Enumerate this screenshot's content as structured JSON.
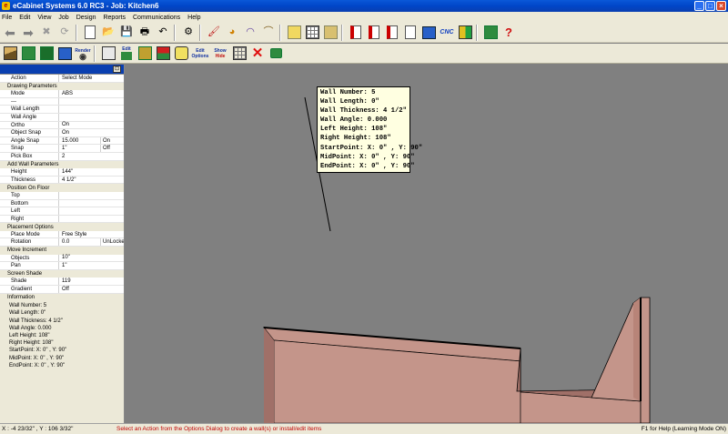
{
  "window": {
    "title": "eCabinet Systems 6.0 RC3 - Job: Kitchen6",
    "buttons": {
      "minimize": "_",
      "maximize": "□",
      "close": "×"
    }
  },
  "menu": [
    "File",
    "Edit",
    "View",
    "Job",
    "Design",
    "Reports",
    "Communications",
    "Help"
  ],
  "toolbar1": [
    {
      "name": "back-arrow-icon",
      "glyph": "⬅"
    },
    {
      "name": "forward-arrow-icon",
      "glyph": "➡"
    },
    {
      "name": "stop-icon",
      "glyph": "✖"
    },
    {
      "name": "refresh-icon",
      "glyph": "⟳"
    },
    {
      "name": "new-document-icon"
    },
    {
      "name": "open-folder-icon",
      "glyph": "📂"
    },
    {
      "name": "save-icon",
      "glyph": "💾"
    },
    {
      "name": "print-icon",
      "glyph": "🖶"
    },
    {
      "name": "undo-icon",
      "glyph": "↶"
    },
    {
      "name": "settings-sliders-icon",
      "glyph": "⚙"
    },
    {
      "name": "paint-icon",
      "glyph": "🖌"
    },
    {
      "name": "color-wheel-icon",
      "glyph": "◕"
    },
    {
      "name": "arc-tool-icon",
      "glyph": "◠"
    },
    {
      "name": "arch-tool-icon",
      "glyph": "⌒"
    },
    {
      "name": "cabinet-icon"
    },
    {
      "name": "material-grid-icon"
    },
    {
      "name": "hardware-icon"
    },
    {
      "name": "report-icon"
    },
    {
      "name": "report-sheet-icon"
    },
    {
      "name": "report-list-icon"
    },
    {
      "name": "report-options-icon"
    },
    {
      "name": "export-settings-icon"
    },
    {
      "name": "cnc-icon",
      "text": "CNC"
    },
    {
      "name": "layout-icon"
    },
    {
      "name": "optimizer-icon"
    },
    {
      "name": "help-icon",
      "glyph": "?"
    }
  ],
  "toolbar2": [
    {
      "name": "room-view-icon"
    },
    {
      "name": "elevation-icon"
    },
    {
      "name": "floorplan-icon"
    },
    {
      "name": "house-icon"
    },
    {
      "name": "render-icon",
      "label": "Render"
    },
    {
      "name": "wall-tool-icon"
    },
    {
      "name": "edit-cabinet-icon",
      "label": "Edit"
    },
    {
      "name": "cabinet-parts-icon"
    },
    {
      "name": "assembly-icon"
    },
    {
      "name": "globe-icon"
    },
    {
      "name": "edit-options-icon",
      "label": "Edit",
      "label2": "Options"
    },
    {
      "name": "show-hide-icon",
      "label": "Show",
      "label2": "Hide"
    },
    {
      "name": "grid-icon"
    },
    {
      "name": "delete-icon",
      "glyph": "✕"
    },
    {
      "name": "camera-icon",
      "glyph": "📷"
    }
  ],
  "options_panel": {
    "action_label": "Action",
    "action_value": "Select Mode",
    "sections": [
      {
        "title": "Drawing Parameters",
        "rows": [
          {
            "k": "Mode",
            "v": "ABS"
          },
          {
            "k": "---",
            "v": ""
          },
          {
            "k": "Wall Length",
            "v": ""
          },
          {
            "k": "Wall Angle",
            "v": ""
          },
          {
            "k": "Ortho",
            "v": "On"
          },
          {
            "k": "Object Snap",
            "v": "On"
          },
          {
            "k": "Angle Snap",
            "v": "15.000",
            "v2": "On"
          },
          {
            "k": "Snap",
            "v": "1\"",
            "v2": "Off"
          },
          {
            "k": "Pick Box",
            "v": "2"
          }
        ]
      },
      {
        "title": "Add Wall Parameters",
        "rows": [
          {
            "k": "Height",
            "v": "144\""
          },
          {
            "k": "Thickness",
            "v": "4 1/2\""
          }
        ]
      },
      {
        "title": "Position On Floor",
        "rows": [
          {
            "k": "Top",
            "v": ""
          },
          {
            "k": "Bottom",
            "v": ""
          },
          {
            "k": "Left",
            "v": ""
          },
          {
            "k": "Right",
            "v": ""
          }
        ]
      },
      {
        "title": "Placement Options",
        "rows": [
          {
            "k": "Place Mode",
            "v": "Free Style"
          },
          {
            "k": "Rotation",
            "v": "0.0",
            "v2": "UnLocked"
          }
        ]
      },
      {
        "title": "Move Increment",
        "rows": [
          {
            "k": "Objects",
            "v": "10\""
          },
          {
            "k": "Pan",
            "v": "1\""
          }
        ]
      },
      {
        "title": "Screen Shade",
        "rows": [
          {
            "k": "Shade",
            "v": "119"
          },
          {
            "k": "Gradient",
            "v": "Off"
          }
        ]
      }
    ],
    "information_title": "Information",
    "information": [
      "Wall Number: 5",
      "Wall Length: 0\"",
      "Wall Thickness: 4 1/2\"",
      "Wall Angle: 0.000",
      "Left Height: 108\"",
      "Right Height: 108\"",
      "StartPoint: X: 0\" , Y: 90\"",
      "MidPoint:  X: 0\" , Y: 90\"",
      "EndPoint:  X: 0\" , Y: 90\""
    ]
  },
  "tooltip": [
    "Wall Number: 5",
    "Wall Length: 0\"",
    "Wall Thickness: 4 1/2\"",
    "Wall Angle: 0.000",
    "Left Height: 108\"",
    "Right Height: 108\"",
    "StartPoint: X: 0\" , Y: 90\"",
    "MidPoint:  X: 0\" , Y: 90\"",
    "EndPoint:  X: 0\" , Y: 90\""
  ],
  "status": {
    "coords": "X : -4 23/32\" , Y : 106 3/32\"",
    "message": "Select an Action from the Options Dialog to create a wall(s) or install/edit items",
    "help": "F1 for Help (Learning Mode ON)"
  },
  "colors": {
    "canvas_bg": "#808080",
    "wall_top": "#c4958a",
    "wall_side": "#a07068",
    "titlebar": "#0a58d8"
  }
}
